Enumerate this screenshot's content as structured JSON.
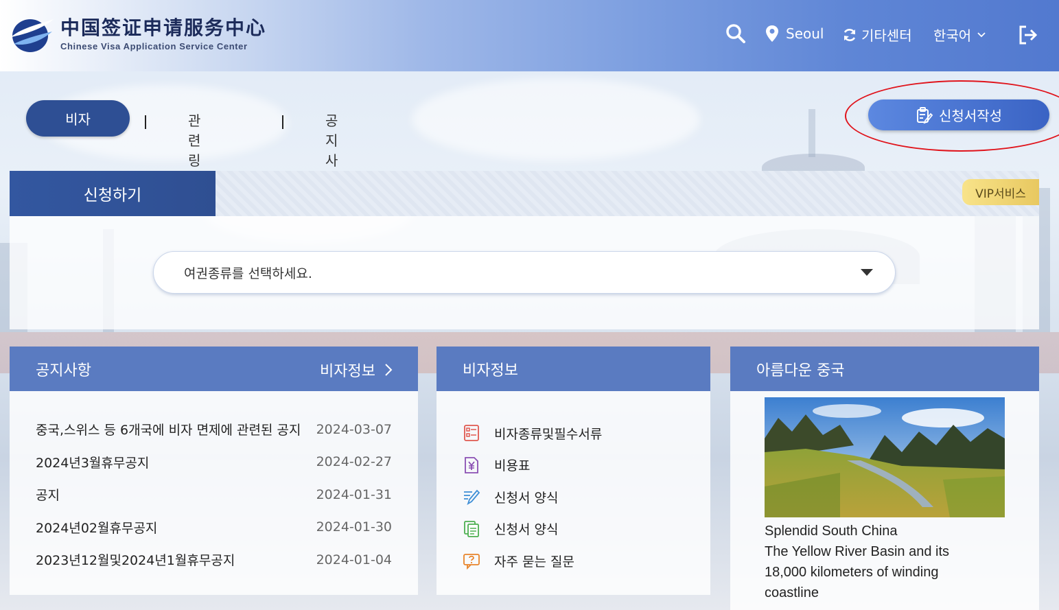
{
  "header": {
    "logo_cn": "中国签证申请服务中心",
    "logo_en": "Chinese Visa Application Service Center",
    "location": "Seoul",
    "other_center": "기타센터",
    "language": "한국어"
  },
  "nav": {
    "tabs": [
      {
        "label": "비자",
        "active": true
      },
      {
        "label": "관련링크",
        "active": false
      },
      {
        "label": "공지사항",
        "active": false
      }
    ],
    "apply_button": "신청서작성"
  },
  "apply_panel": {
    "title": "신청하기",
    "vip": "VIP서비스",
    "passport_placeholder": "여권종류를 선택하세요."
  },
  "notice_panel": {
    "title": "공지사항",
    "more": "비자정보",
    "items": [
      {
        "title": "중국,스위스 등 6개국에 비자 면제에 관련된 공지",
        "date": "2024-03-07"
      },
      {
        "title": "2024년3월휴무공지",
        "date": "2024-02-27"
      },
      {
        "title": "공지",
        "date": "2024-01-31"
      },
      {
        "title": "2024년02월휴무공지",
        "date": "2024-01-30"
      },
      {
        "title": "2023년12월및2024년1월휴무공지",
        "date": "2024-01-04"
      }
    ]
  },
  "visa_panel": {
    "title": "비자정보",
    "items": [
      {
        "label": "비자종류및필수서류",
        "icon": "document-list-icon",
        "color": "#e0584f"
      },
      {
        "label": "비용표",
        "icon": "yen-icon",
        "color": "#8a4fb3"
      },
      {
        "label": "신청서 양식",
        "icon": "pen-form-icon",
        "color": "#3f8fd6"
      },
      {
        "label": "신청서 양식",
        "icon": "copy-document-icon",
        "color": "#4caf50"
      },
      {
        "label": "자주 묻는 질문",
        "icon": "faq-chat-icon",
        "color": "#e8842a"
      }
    ]
  },
  "china_panel": {
    "title": "아름다운 중국",
    "caption_lines": [
      "Splendid South China",
      "The Yellow River Basin and its",
      "18,000 kilometers of winding",
      "coastline"
    ]
  }
}
